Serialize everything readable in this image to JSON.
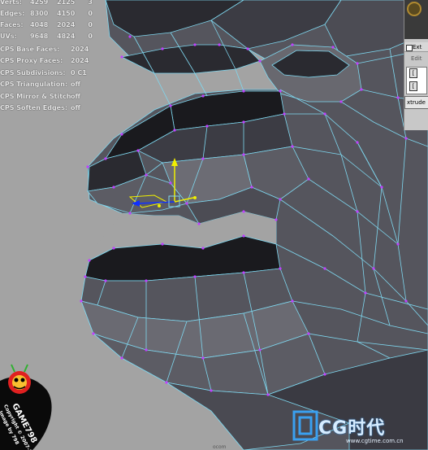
{
  "stats": [
    {
      "label": "Verts:",
      "v1": "4259",
      "v2": "2125",
      "v3": "3"
    },
    {
      "label": "Edges:",
      "v1": "8300",
      "v2": "4150",
      "v3": "0"
    },
    {
      "label": "Faces:",
      "v1": "4048",
      "v2": "2024",
      "v3": "0"
    },
    {
      "label": "UVs:",
      "v1": "9648",
      "v2": "4824",
      "v3": "0"
    }
  ],
  "cps": [
    {
      "label": "CPS Base Faces:",
      "value": "2024"
    },
    {
      "label": "CPS Proxy Faces:",
      "value": "2024"
    },
    {
      "label": "CPS Subdivisions:",
      "value": "0 C1"
    },
    {
      "label": "CPS Triangulation:",
      "value": "off"
    },
    {
      "label": "CPS Mirror & Stitch:",
      "value": "off"
    },
    {
      "label": "CPS Soften Edges:",
      "value": "off"
    }
  ],
  "panel": {
    "title": "Ext",
    "edit": "Edit",
    "btn1": "[",
    "btn2": "[",
    "extrude": "xtrude"
  },
  "badge": {
    "name": "GAME798",
    "copyright": "Copyright © 2007-2",
    "image_by": "Image by 798"
  },
  "watermark": {
    "text": "CG时代",
    "url": "www.cgtime.com.cn"
  },
  "bottom_text": "ocom",
  "colors": {
    "viewport_bg": "#a3a3a3",
    "face_dark": "#1a1a1e",
    "face_mid": "#55555d",
    "face_light": "#6c6c74",
    "wire": "#7fd8f0",
    "vertex": "#c040ff",
    "manip_y": "#f0f000",
    "manip_x": "#1030ff"
  }
}
